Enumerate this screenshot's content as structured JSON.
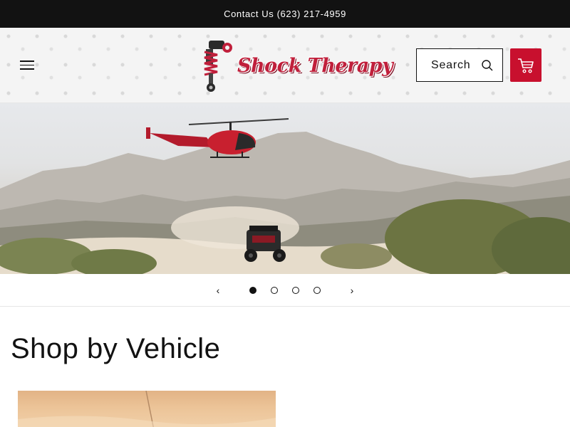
{
  "announcement": {
    "text": "Contact Us (623) 217-4959"
  },
  "header": {
    "menu_icon": "hamburger-menu-icon",
    "logo_text": "Shock Therapy",
    "search": {
      "label": "Search",
      "icon": "search-icon"
    },
    "cart": {
      "icon": "cart-icon",
      "color": "#c8102e"
    }
  },
  "hero": {
    "slide_count": 4,
    "active_slide": 1,
    "prev_icon": "chevron-left-icon",
    "next_icon": "chevron-right-icon"
  },
  "shop_by_vehicle": {
    "title": "Shop by Vehicle"
  },
  "colors": {
    "accent": "#c8102e",
    "dark": "#121212",
    "announcement_bg": "#121212"
  }
}
